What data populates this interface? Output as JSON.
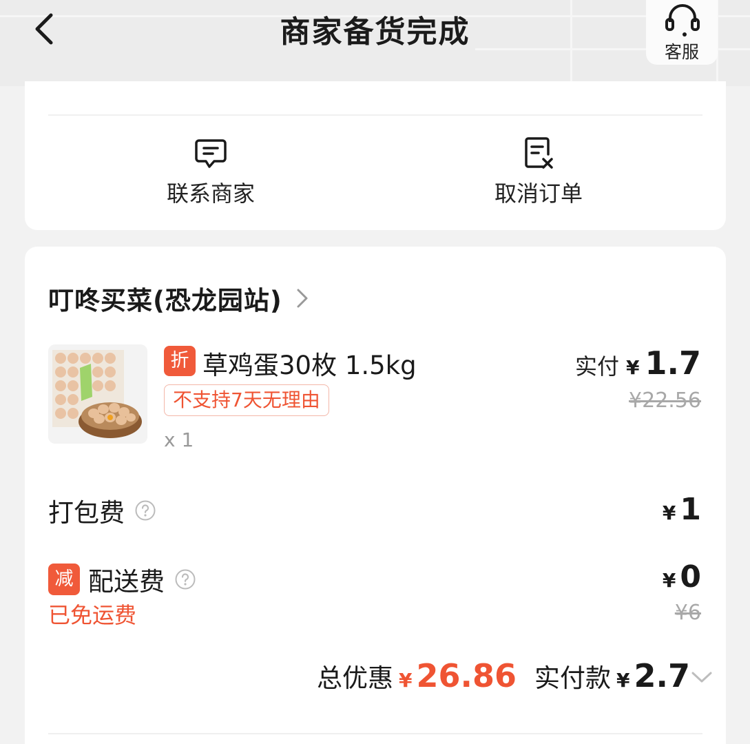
{
  "header": {
    "title": "商家备货完成",
    "service_label": "客服"
  },
  "actions": {
    "contact_label": "联系商家",
    "cancel_label": "取消订单"
  },
  "order": {
    "store_name": "叮咚买菜(恐龙园站)",
    "product": {
      "discount_tag": "折",
      "name": "草鸡蛋30枚 1.5kg",
      "return_policy": "不支持7天无理由",
      "quantity": "x 1",
      "paid_label": "实付",
      "paid_yen": "¥",
      "paid_value": "1.7",
      "original_price": "¥22.56"
    },
    "packing_fee": {
      "label": "打包费",
      "yen": "¥",
      "value": "1"
    },
    "delivery_fee": {
      "tag": "减",
      "label": "配送费",
      "yen": "¥",
      "value": "0",
      "original": "¥6",
      "note": "已免运费"
    },
    "summary": {
      "discount_label": "总优惠",
      "discount_yen": "¥",
      "discount_value": "26.86",
      "paid_label": "实付款",
      "paid_yen": "¥",
      "paid_value": "2.7"
    }
  },
  "colors": {
    "accent": "#ef5433",
    "tag_bg": "#f05a3a",
    "muted": "#a8a8a8"
  }
}
